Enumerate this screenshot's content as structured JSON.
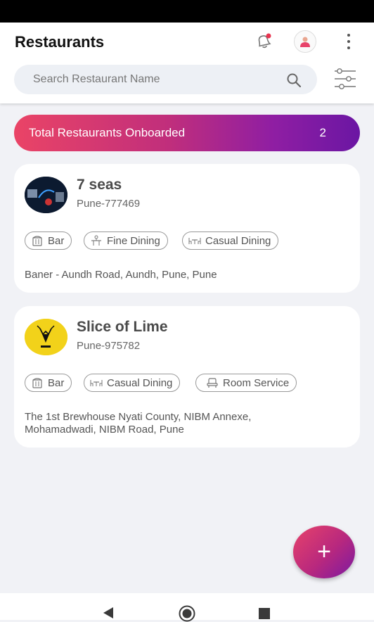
{
  "header": {
    "title": "Restaurants"
  },
  "search": {
    "placeholder": "Search Restaurant Name",
    "value": ""
  },
  "banner": {
    "label": "Total Restaurants Onboarded",
    "count": "2"
  },
  "restaurants": [
    {
      "name": "7 seas",
      "code": "Pune-777469",
      "tags": [
        {
          "label": "Bar",
          "icon": "bar-icon"
        },
        {
          "label": "Fine Dining",
          "icon": "fine-dining-icon"
        },
        {
          "label": "Casual Dining",
          "icon": "casual-dining-icon"
        }
      ],
      "address": "Baner - Aundh Road, Aundh, Pune, Pune"
    },
    {
      "name": "Slice of Lime",
      "code": "Pune-975782",
      "tags": [
        {
          "label": "Bar",
          "icon": "bar-icon"
        },
        {
          "label": "Casual Dining",
          "icon": "casual-dining-icon"
        },
        {
          "label": "Room Service",
          "icon": "room-service-icon"
        }
      ],
      "address_line1": "The 1st Brewhouse Nyati County, NIBM Annexe,",
      "address_line2": "Mohamadwadi, NIBM Road, Pune"
    }
  ],
  "fab": {
    "label": "+"
  },
  "colors": {
    "accent_start": "#ea4466",
    "accent_end": "#6b16a3",
    "background": "#f1f2f6"
  }
}
